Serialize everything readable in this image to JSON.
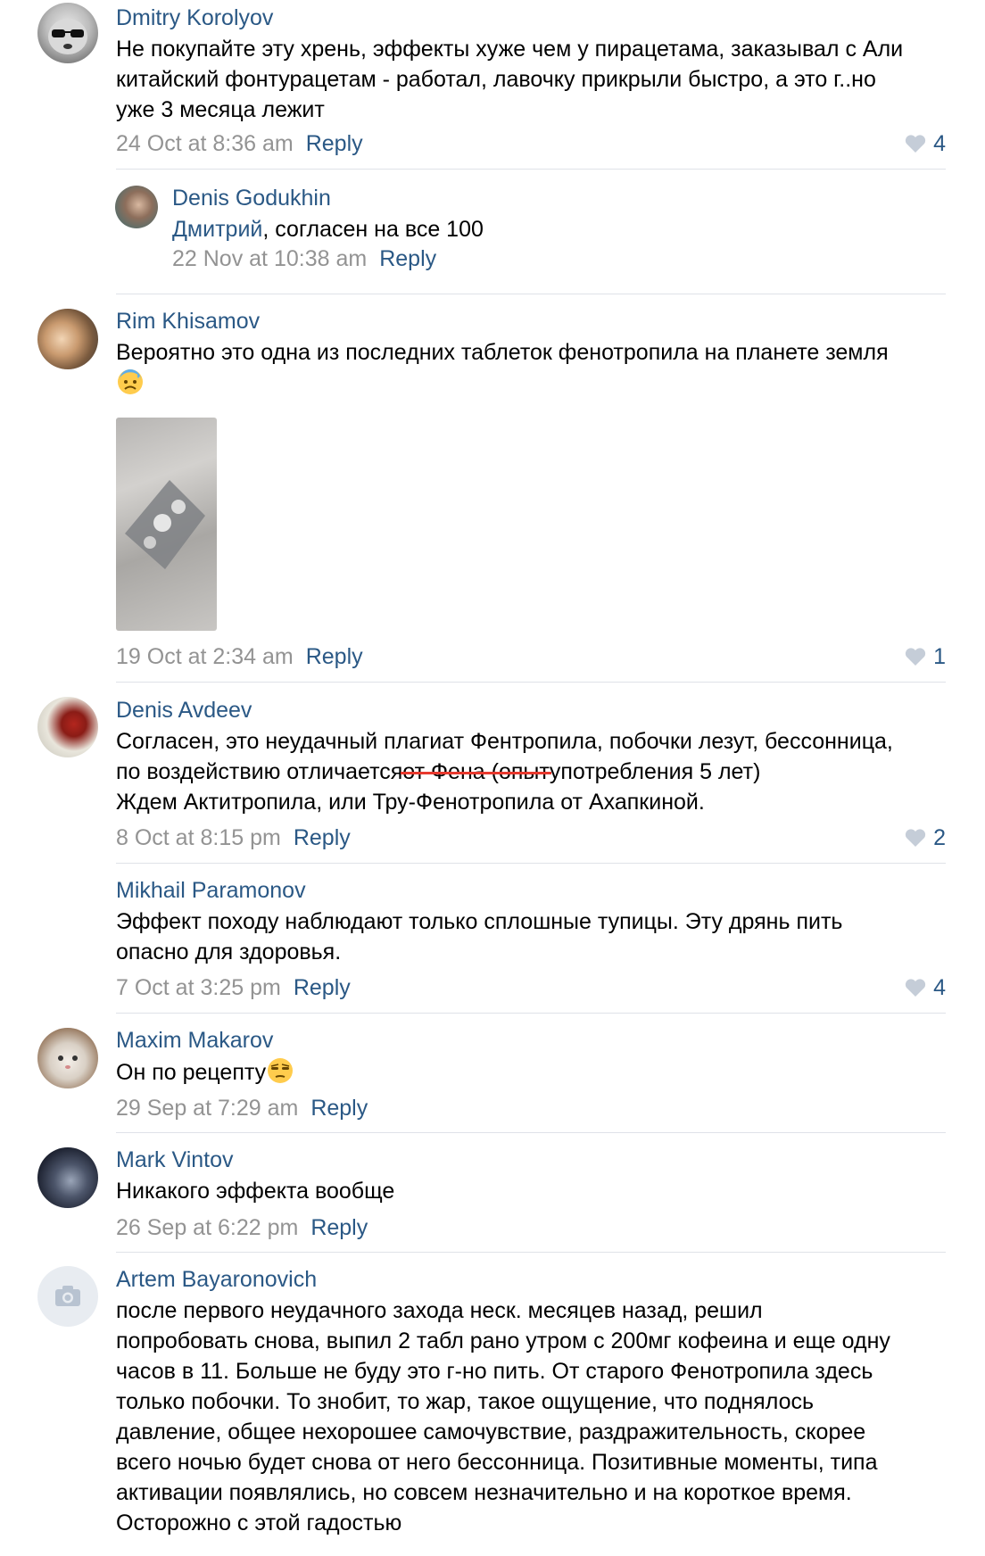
{
  "comments": [
    {
      "author": "Dmitry Korolyov",
      "lines": [
        "Не покупайте эту хрень, эффекты хуже чем у пирацетама, заказывал с Али",
        "китайский фонтурацетам - работал, лавочку прикрыли быстро, а это г..но",
        "уже 3 месяца лежит"
      ],
      "date": "24 Oct at 8:36 am",
      "reply": "Reply",
      "likes": "4"
    },
    {
      "author": "Denis Godukhin",
      "mention": "Дмитрий",
      "text_after_mention": ", согласен на все 100",
      "date": "22 Nov at 10:38 am",
      "reply": "Reply"
    },
    {
      "author": "Rim Khisamov",
      "lines": [
        "Вероятно это одна из последних таблеток фенотропила на планете земля"
      ],
      "emoji": "cold-sweat-emoji",
      "date": "19 Oct at 2:34 am",
      "reply": "Reply",
      "likes": "1"
    },
    {
      "author": "Denis Avdeev",
      "line1": "Согласен, это неудачный плагиат Фентропила, побочки лезут, бессонница,",
      "line2_start": "по воздействию отличается",
      "line2_struck": " от Фена (опыт ",
      "line2_end": "употребления 5 лет)",
      "line3": "Ждем Актитропила, или Тру-Фенотропила от Ахапкиной.",
      "date": "8 Oct at 8:15 pm",
      "reply": "Reply",
      "likes": "2"
    },
    {
      "author": "Mikhail Paramonov",
      "lines": [
        "Эффект походу наблюдают только сплошные тупицы. Эту дрянь пить",
        "опасно для здоровья."
      ],
      "date": "7 Oct at 3:25 pm",
      "reply": "Reply",
      "likes": "4"
    },
    {
      "author": "Maxim Makarov",
      "lines": [
        "Он по рецепту"
      ],
      "emoji": "unamused-face-emoji",
      "date": "29 Sep at 7:29 am",
      "reply": "Reply"
    },
    {
      "author": "Mark Vintov",
      "lines": [
        "Никакого эффекта вообще"
      ],
      "date": "26 Sep at 6:22 pm",
      "reply": "Reply"
    },
    {
      "author": "Artem Bayaronovich",
      "lines": [
        "после первого неудачного захода неск. месяцев назад, решил",
        "попробовать снова, выпил 2 табл рано утром с 200мг кофеина и еще одну",
        "часов в 11. Больше не буду это г-но пить. От старого Фенотропила здесь",
        "только побочки. То знобит, то жар, такое ощущение, что поднялось",
        "давление, общее нехорошее самочувствие, раздражительность, скорее",
        "всего ночью будет снова от него бессонница. Позитивные моменты, типа",
        "активации появлялись, но совсем незначительно и на короткое время.",
        "Осторожно с этой гадостью"
      ]
    }
  ],
  "colors": {
    "link": "#2a5885",
    "date": "#939393",
    "separator": "#dfe2e8",
    "strike": "#e8392e"
  }
}
